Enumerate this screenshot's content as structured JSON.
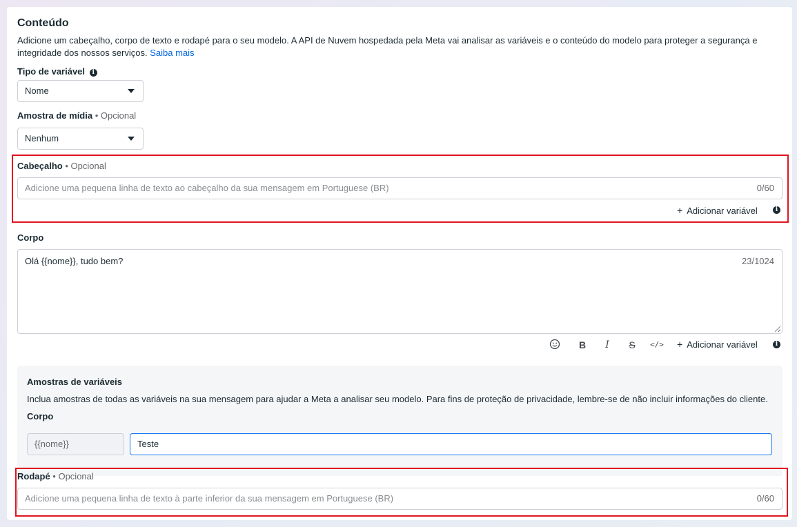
{
  "content": {
    "title": "Conteúdo",
    "description": "Adicione um cabeçalho, corpo de texto e rodapé para o seu modelo. A API de Nuvem hospedada pela Meta vai analisar as variáveis e o conteúdo do modelo para proteger a segurança e integridade dos nossos serviços.",
    "learn_more": "Saiba mais"
  },
  "variable_type": {
    "label": "Tipo de variável",
    "selected": "Nome"
  },
  "media_sample": {
    "label": "Amostra de mídia",
    "optional": "• Opcional",
    "selected": "Nenhum"
  },
  "header": {
    "label": "Cabeçalho",
    "optional": "• Opcional",
    "placeholder": "Adicione uma pequena linha de texto ao cabeçalho da sua mensagem em Portuguese (BR)",
    "counter": "0/60",
    "add_variable": "Adicionar variável"
  },
  "body": {
    "label": "Corpo",
    "value": "Olá {{nome}}, tudo bem?",
    "counter": "23/1024",
    "add_variable": "Adicionar variável",
    "toolbar": [
      "emoji-icon",
      "bold-icon",
      "italic-icon",
      "strikethrough-icon",
      "code-icon"
    ]
  },
  "variable_samples": {
    "title": "Amostras de variáveis",
    "description": "Inclua amostras de todas as variáveis na sua mensagem para ajudar a Meta a analisar seu modelo. Para fins de proteção de privacidade, lembre-se de não incluir informações do cliente.",
    "section": "Corpo",
    "variable_name": "{{nome}}",
    "variable_value": "Teste"
  },
  "footer": {
    "label": "Rodapé",
    "optional": "• Opcional",
    "placeholder": "Adicione uma pequena linha de texto à parte inferior da sua mensagem em Portuguese (BR)",
    "counter": "0/60"
  },
  "colors": {
    "highlight": "#e0141e",
    "link": "#0064e0",
    "focus": "#1877f2"
  }
}
